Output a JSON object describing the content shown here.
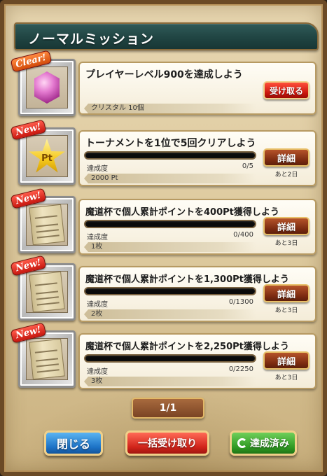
{
  "header": {
    "title": "ノーマルミッション"
  },
  "missions": [
    {
      "badge": "Clear!",
      "icon": "crystal-gem-icon",
      "title": "プレイヤーレベル900を達成しよう",
      "reward": "クリスタル 10個",
      "action_label": "受け取る",
      "status": "clear"
    },
    {
      "badge": "New!",
      "icon": "pt-star-icon",
      "icon_text": "Pt",
      "title": "トーナメントを1位で5回クリアしよう",
      "progress_label": "達成度",
      "progress_value": "0/5",
      "progress": 0,
      "reward": "2000 Pt",
      "action_label": "詳細",
      "remaining": "あと2日"
    },
    {
      "badge": "New!",
      "icon": "scroll-icon",
      "title": "魔道杯で個人累計ポイントを400Pt獲得しよう",
      "progress_label": "達成度",
      "progress_value": "0/400",
      "progress": 0,
      "reward": "1枚",
      "action_label": "詳細",
      "remaining": "あと3日"
    },
    {
      "badge": "New!",
      "icon": "scroll-icon",
      "title": "魔道杯で個人累計ポイントを1,300Pt獲得しよう",
      "progress_label": "達成度",
      "progress_value": "0/1300",
      "progress": 0,
      "reward": "2枚",
      "action_label": "詳細",
      "remaining": "あと3日"
    },
    {
      "badge": "New!",
      "icon": "scroll-icon",
      "title": "魔道杯で個人累計ポイントを2,250Pt獲得しよう",
      "progress_label": "達成度",
      "progress_value": "0/2250",
      "progress": 0,
      "reward": "3枚",
      "action_label": "詳細",
      "remaining": "あと3日"
    }
  ],
  "pager": {
    "label": "1/1"
  },
  "footer": {
    "close_label": "閉じる",
    "bulk_receive_label": "一括受け取り",
    "completed_label": "達成済み"
  }
}
